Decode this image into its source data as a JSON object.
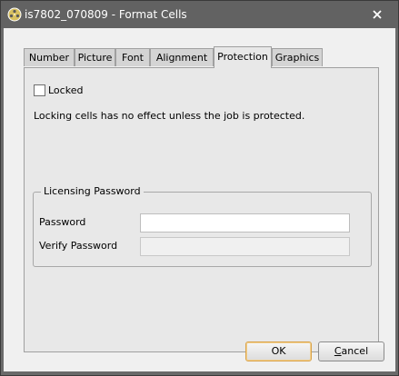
{
  "window": {
    "title": "is7802_070809 - Format Cells",
    "app_icon": "film-reel-icon",
    "close_icon": "close-x-icon"
  },
  "tabs": [
    {
      "label": "Number",
      "active": false
    },
    {
      "label": "Picture",
      "active": false
    },
    {
      "label": "Font",
      "active": false
    },
    {
      "label": "Alignment",
      "active": false
    },
    {
      "label": "Protection",
      "active": true
    },
    {
      "label": "Graphics",
      "active": false
    }
  ],
  "protection": {
    "locked_label": "Locked",
    "locked_checked": false,
    "note": "Locking cells has no effect unless the job is protected."
  },
  "licensing": {
    "group_title": "Licensing Password",
    "password_label": "Password",
    "password_value": "",
    "verify_label": "Verify Password",
    "verify_value": "",
    "verify_enabled": false
  },
  "buttons": {
    "ok": "OK",
    "cancel_prefix": "C",
    "cancel_rest": "ancel"
  }
}
